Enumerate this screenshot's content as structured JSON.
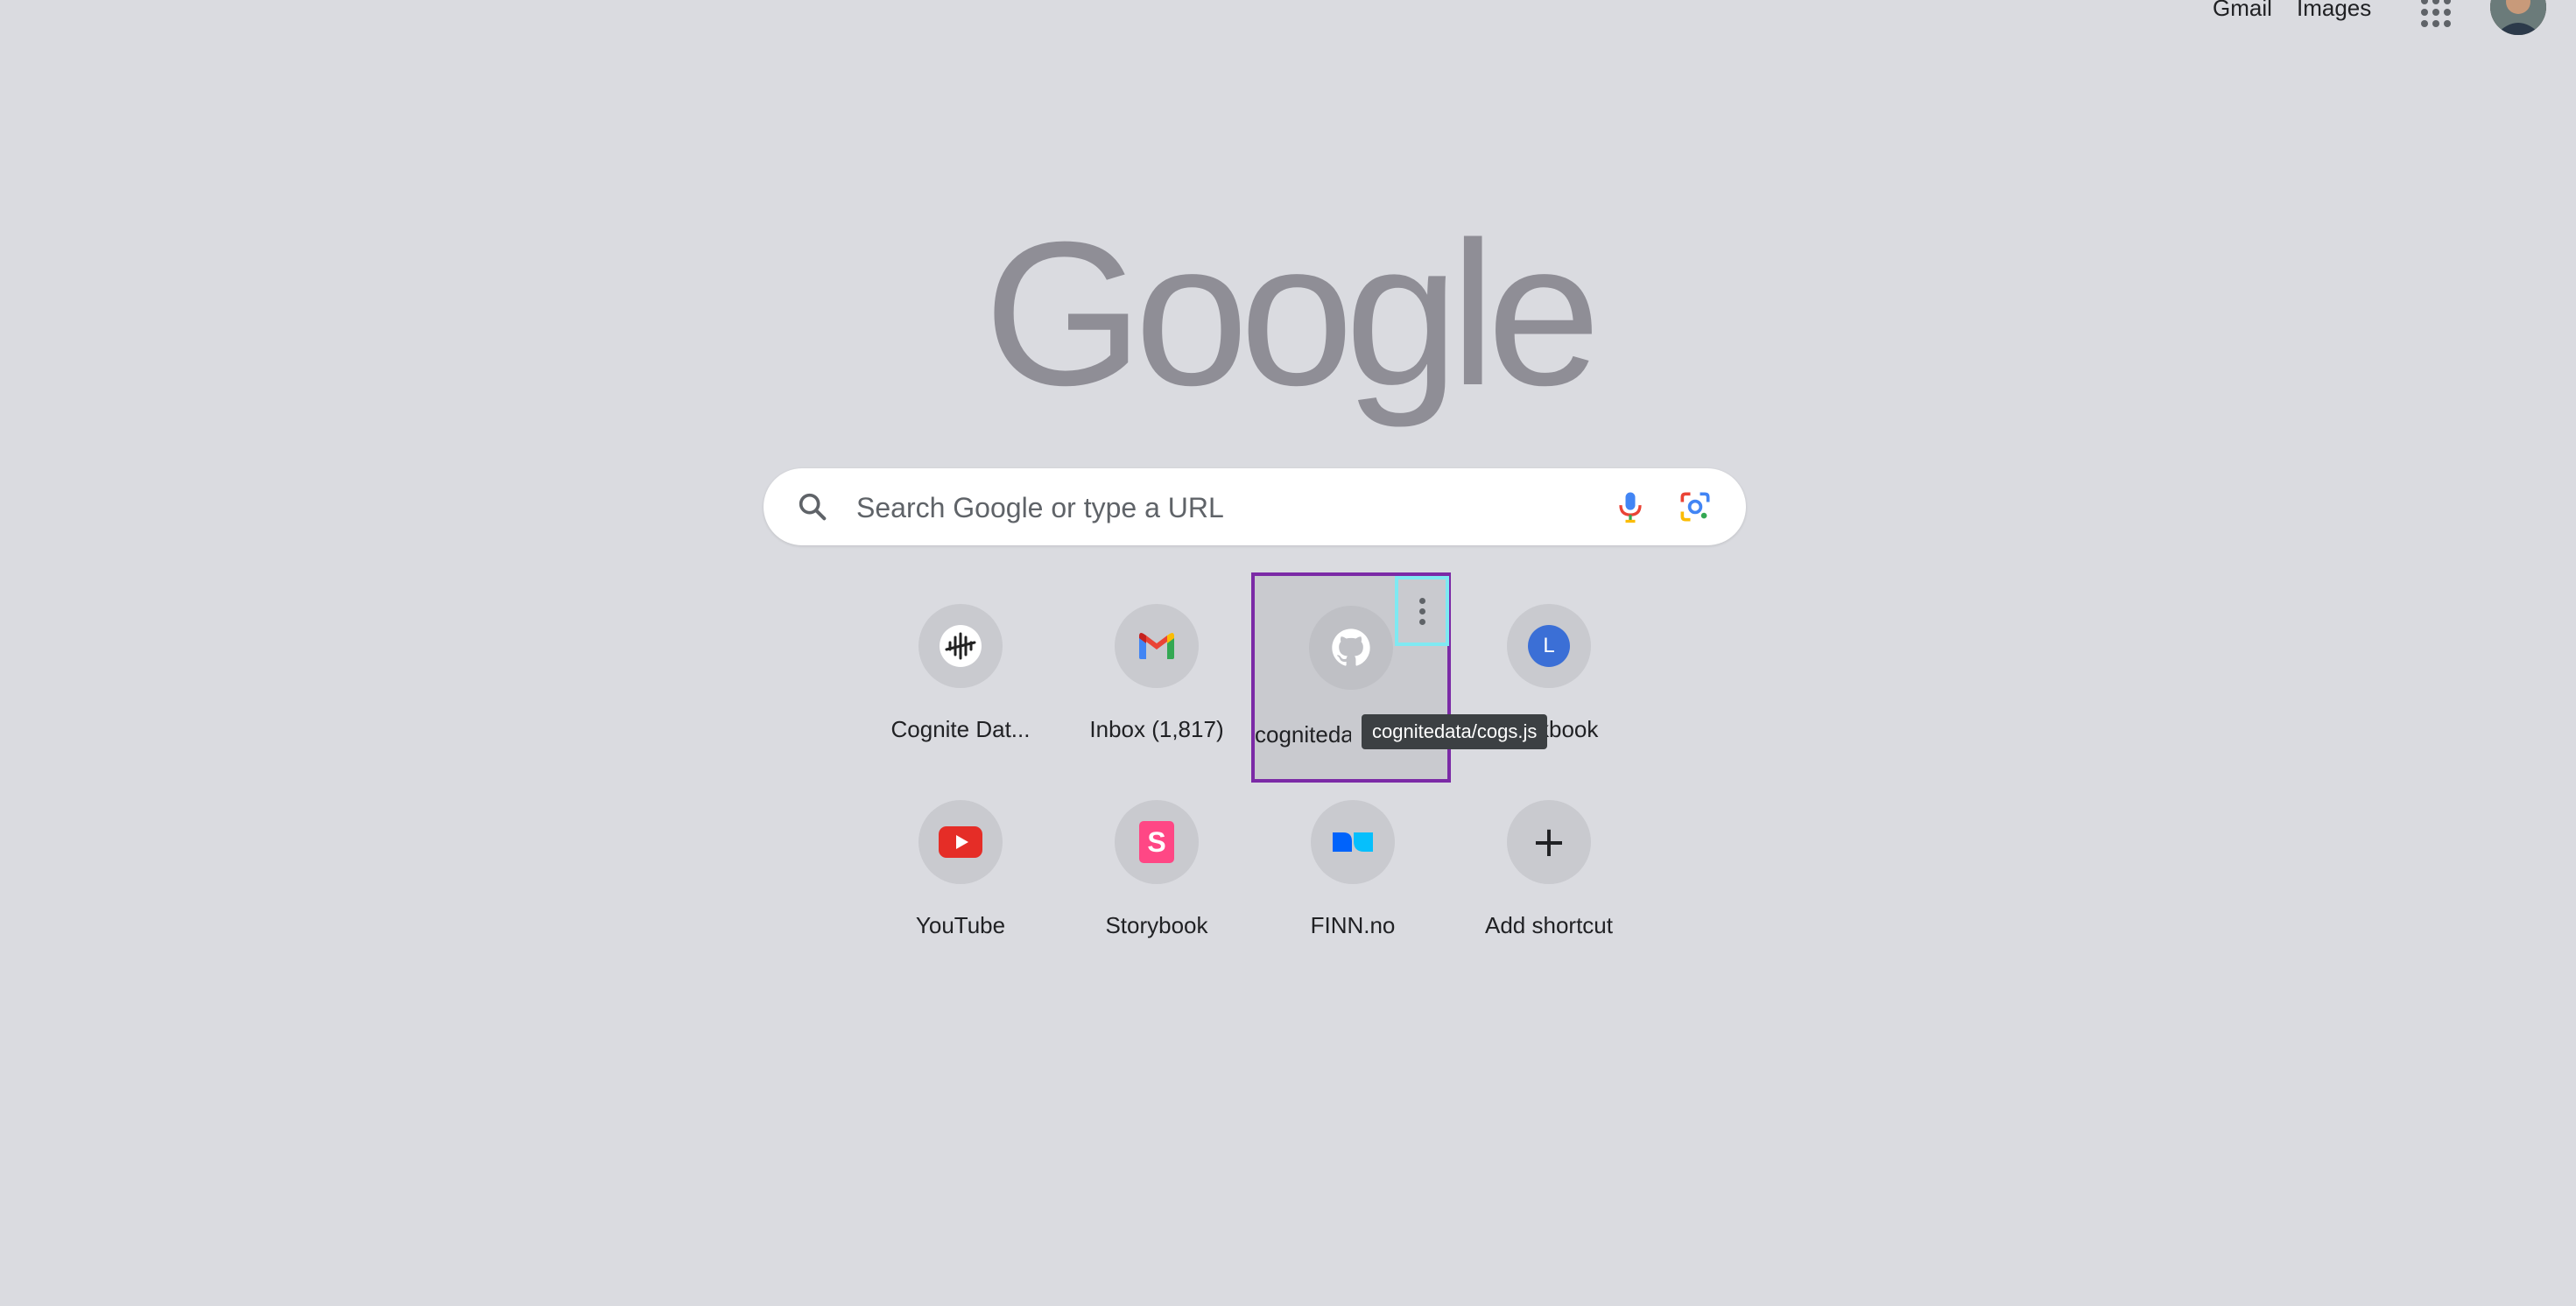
{
  "header": {
    "gmail_label": "Gmail",
    "images_label": "Images",
    "apps_icon": "apps-grid-icon",
    "avatar_icon": "profile-avatar"
  },
  "logo": {
    "text": "Google",
    "color": "#8f8e96"
  },
  "search": {
    "placeholder": "Search Google or type a URL",
    "value": "",
    "search_icon": "search-icon",
    "voice_icon": "mic-icon",
    "lens_icon": "lens-icon"
  },
  "shortcuts": [
    {
      "label": "Cognite Dat...",
      "icon": "cognite-icon"
    },
    {
      "label": "Inbox (1,817)",
      "icon": "gmail-icon"
    },
    {
      "label": "cognitedata/cogs.js",
      "icon": "github-icon",
      "highlighted": true
    },
    {
      "label": "Lookbook",
      "icon": "letter-l-icon",
      "letter": "L",
      "icon_color": "#3b6fd6"
    },
    {
      "label": "YouTube",
      "icon": "youtube-icon"
    },
    {
      "label": "Storybook",
      "icon": "storybook-icon",
      "letter": "S"
    },
    {
      "label": "FINN.no",
      "icon": "finn-icon"
    },
    {
      "label": "Add shortcut",
      "icon": "plus-icon",
      "glyph": "+"
    }
  ],
  "tooltip": {
    "text": "cognitedata/cogs.js"
  },
  "colors": {
    "background": "#dadbe0",
    "highlight_border": "#7b2aa6",
    "more_button_border": "#7fe9f2",
    "youtube_red": "#e52d27",
    "storybook_pink": "#ff4785"
  }
}
